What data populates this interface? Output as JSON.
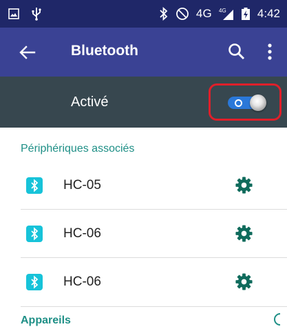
{
  "status_bar": {
    "network": "4G",
    "network_super": "4G",
    "time": "4:42",
    "left_icons": [
      "image-icon",
      "usb-icon"
    ],
    "right_icons": [
      "bluetooth-icon",
      "do-not-disturb-icon",
      "signal-icon",
      "battery-charging-icon"
    ]
  },
  "app_bar": {
    "title": "Bluetooth",
    "icons": [
      "back-arrow-icon",
      "search-icon",
      "overflow-menu-icon"
    ]
  },
  "toggle": {
    "label": "Activé",
    "state": "on",
    "track_color": "#2a78d9",
    "highlight_color": "#e01f2a"
  },
  "paired_section": {
    "header": "Périphériques associés",
    "devices": [
      {
        "name": "HC-05",
        "icon": "bluetooth-icon",
        "action_icon": "gear-icon"
      },
      {
        "name": "HC-06",
        "icon": "bluetooth-icon",
        "action_icon": "gear-icon"
      },
      {
        "name": "HC-06",
        "icon": "bluetooth-icon",
        "action_icon": "gear-icon"
      }
    ]
  },
  "available_section": {
    "header": "Appareils",
    "icon": "progress-spinner-icon"
  },
  "colors": {
    "status_bar": "#1f2768",
    "app_bar": "#3a4294",
    "toggle_row": "#37474f",
    "accent": "#1e8f86",
    "bt_badge": "#17c3d9"
  }
}
